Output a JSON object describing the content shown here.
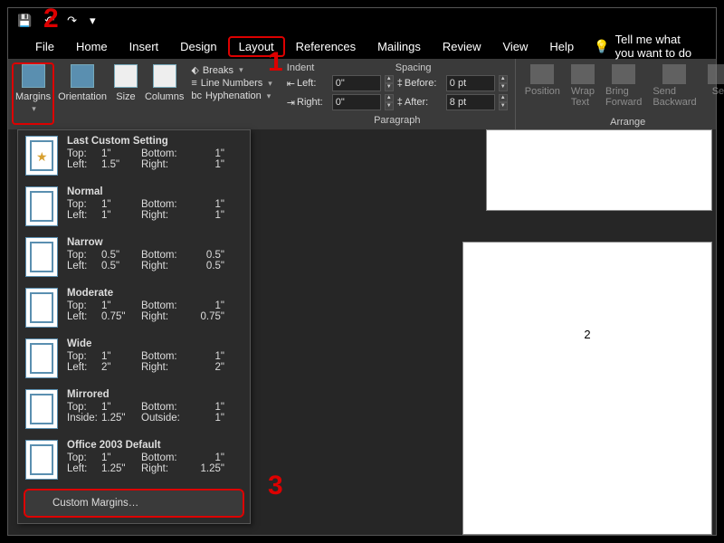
{
  "qat": {
    "save": "💾",
    "undo": "↶",
    "redo": "↷",
    "more": "▾"
  },
  "menu": {
    "file": "File",
    "home": "Home",
    "insert": "Insert",
    "design": "Design",
    "layout": "Layout",
    "references": "References",
    "mailings": "Mailings",
    "review": "Review",
    "view": "View",
    "help": "Help",
    "tell_me": "Tell me what you want to do"
  },
  "ribbon": {
    "margins": "Margins",
    "orientation": "Orientation",
    "size": "Size",
    "columns": "Columns",
    "breaks": "Breaks",
    "line_numbers": "Line Numbers",
    "hyphenation": "Hyphenation",
    "indent_hdr": "Indent",
    "spacing_hdr": "Spacing",
    "left_lbl": "Left:",
    "right_lbl": "Right:",
    "before_lbl": "Before:",
    "after_lbl": "After:",
    "left_val": "0\"",
    "right_val": "0\"",
    "before_val": "0 pt",
    "after_val": "8 pt",
    "paragraph_group": "Paragraph",
    "position": "Position",
    "wrap": "Wrap Text",
    "bring": "Bring Forward",
    "send": "Send Backward",
    "sel": "Sel",
    "arrange_group": "Arrange"
  },
  "dropdown": {
    "items": [
      {
        "title": "Last Custom Setting",
        "k1": "Top:",
        "v1": "1\"",
        "k2": "Bottom:",
        "v2": "1\"",
        "k3": "Left:",
        "v3": "1.5\"",
        "k4": "Right:",
        "v4": "1\""
      },
      {
        "title": "Normal",
        "k1": "Top:",
        "v1": "1\"",
        "k2": "Bottom:",
        "v2": "1\"",
        "k3": "Left:",
        "v3": "1\"",
        "k4": "Right:",
        "v4": "1\""
      },
      {
        "title": "Narrow",
        "k1": "Top:",
        "v1": "0.5\"",
        "k2": "Bottom:",
        "v2": "0.5\"",
        "k3": "Left:",
        "v3": "0.5\"",
        "k4": "Right:",
        "v4": "0.5\""
      },
      {
        "title": "Moderate",
        "k1": "Top:",
        "v1": "1\"",
        "k2": "Bottom:",
        "v2": "1\"",
        "k3": "Left:",
        "v3": "0.75\"",
        "k4": "Right:",
        "v4": "0.75\""
      },
      {
        "title": "Wide",
        "k1": "Top:",
        "v1": "1\"",
        "k2": "Bottom:",
        "v2": "1\"",
        "k3": "Left:",
        "v3": "2\"",
        "k4": "Right:",
        "v4": "2\""
      },
      {
        "title": "Mirrored",
        "k1": "Top:",
        "v1": "1\"",
        "k2": "Bottom:",
        "v2": "1\"",
        "k3": "Inside:",
        "v3": "1.25\"",
        "k4": "Outside:",
        "v4": "1\""
      },
      {
        "title": "Office 2003 Default",
        "k1": "Top:",
        "v1": "1\"",
        "k2": "Bottom:",
        "v2": "1\"",
        "k3": "Left:",
        "v3": "1.25\"",
        "k4": "Right:",
        "v4": "1.25\""
      }
    ],
    "custom": "Custom Margins…"
  },
  "doc": {
    "page2_num": "2"
  },
  "annot": {
    "one": "1",
    "two": "2",
    "three": "3"
  }
}
